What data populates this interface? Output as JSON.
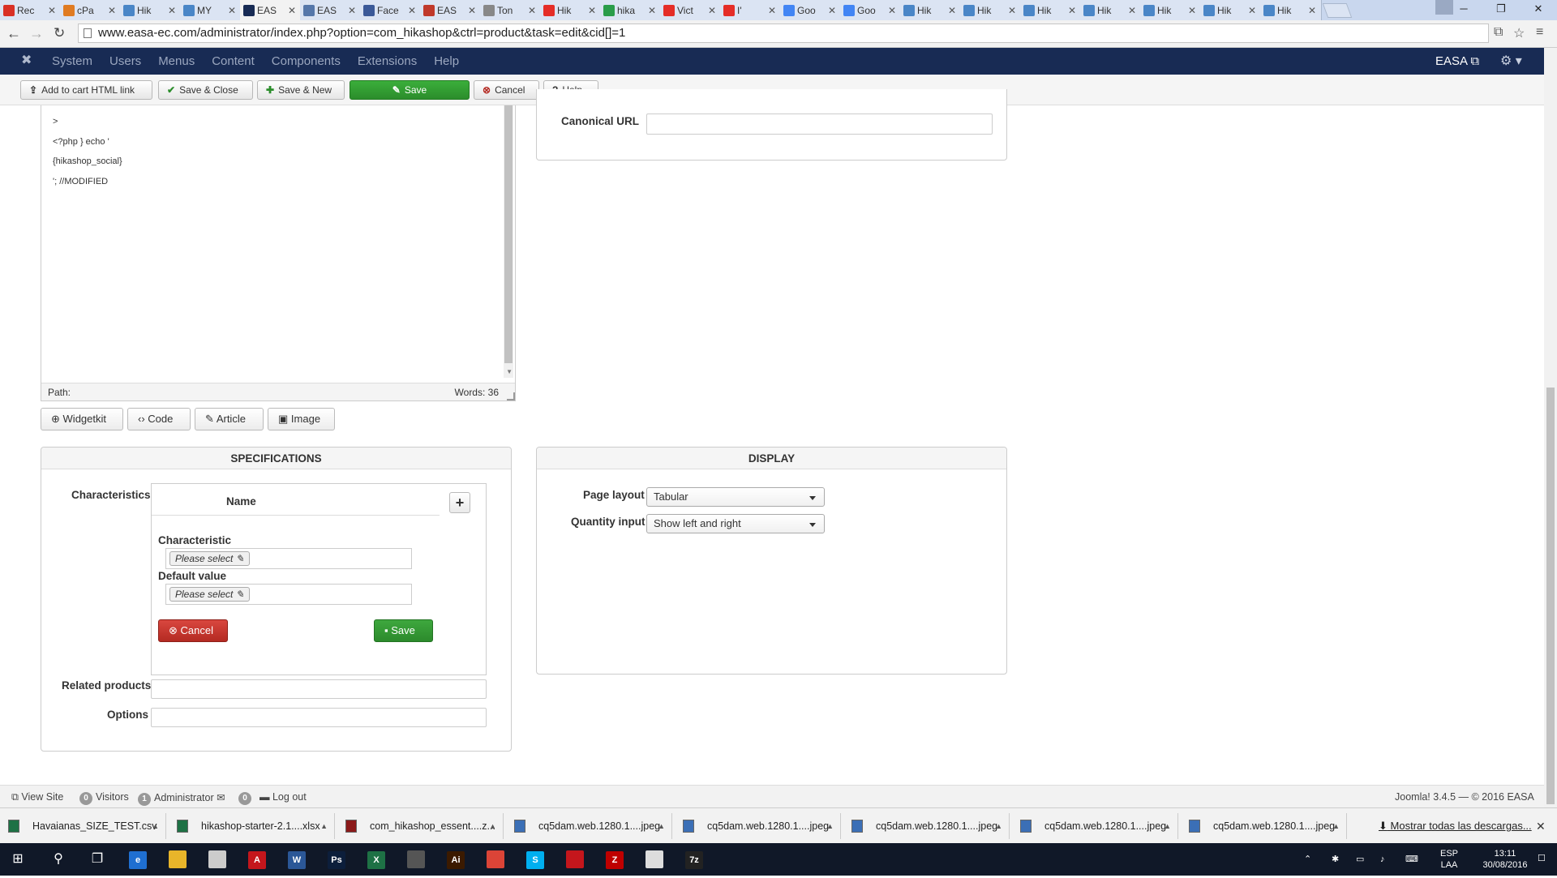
{
  "browser": {
    "tabs": [
      {
        "label": "Rec",
        "color": "#d93025",
        "active": false
      },
      {
        "label": "cPa",
        "color": "#e07b22",
        "active": false
      },
      {
        "label": "Hik",
        "color": "#4a86c7",
        "active": false
      },
      {
        "label": "MY",
        "color": "#4a86c7",
        "active": false
      },
      {
        "label": "EAS",
        "color": "#182b54",
        "active": true
      },
      {
        "label": "EAS",
        "color": "#5577aa",
        "active": false
      },
      {
        "label": "Face",
        "color": "#3b5998",
        "active": false
      },
      {
        "label": "EAS",
        "color": "#c0392b",
        "active": false
      },
      {
        "label": "Ton",
        "color": "#888888",
        "active": false
      },
      {
        "label": "Hik",
        "color": "#e52d27",
        "active": false
      },
      {
        "label": "hika",
        "color": "#2a9d4a",
        "active": false
      },
      {
        "label": "Vict",
        "color": "#e52d27",
        "active": false
      },
      {
        "label": "I'",
        "color": "#e52d27",
        "active": false
      },
      {
        "label": "Goo",
        "color": "#4285f4",
        "active": false
      },
      {
        "label": "Goo",
        "color": "#4285f4",
        "active": false
      },
      {
        "label": "Hik",
        "color": "#4a86c7",
        "active": false
      },
      {
        "label": "Hik",
        "color": "#4a86c7",
        "active": false
      },
      {
        "label": "Hik",
        "color": "#4a86c7",
        "active": false
      },
      {
        "label": "Hik",
        "color": "#4a86c7",
        "active": false
      },
      {
        "label": "Hik",
        "color": "#4a86c7",
        "active": false
      },
      {
        "label": "Hik",
        "color": "#4a86c7",
        "active": false
      },
      {
        "label": "Hik",
        "color": "#4a86c7",
        "active": false
      }
    ],
    "url": "www.easa-ec.com/administrator/index.php?option=com_hikashop&ctrl=product&task=edit&cid[]=1"
  },
  "joomla": {
    "menu": [
      "System",
      "Users",
      "Menus",
      "Content",
      "Components",
      "Extensions",
      "Help"
    ],
    "site": "EASA"
  },
  "toolbar": {
    "add_cart": "Add to cart HTML link",
    "save_close": "Save & Close",
    "save_new": "Save & New",
    "save": "Save",
    "cancel": "Cancel",
    "help": "Help"
  },
  "editor": {
    "lines": [
      ">",
      "<?php } echo '",
      "{hikashop_social}",
      "'; //MODIFIED"
    ],
    "path": "Path:",
    "words": "Words: 36",
    "buttons": {
      "widgetkit": "Widgetkit",
      "code": "Code",
      "article": "Article",
      "image": "Image"
    }
  },
  "seo": {
    "canonical_label": "Canonical URL",
    "canonical_value": ""
  },
  "specifications": {
    "title": "SPECIFICATIONS",
    "characteristics_label": "Characteristics",
    "name_header": "Name",
    "characteristic_label": "Characteristic",
    "characteristic_placeholder": "Please select",
    "default_label": "Default value",
    "default_placeholder": "Please select",
    "cancel": "Cancel",
    "save": "Save",
    "related_label": "Related products",
    "options_label": "Options"
  },
  "display": {
    "title": "DISPLAY",
    "layout_label": "Page layout",
    "layout_value": "Tabular",
    "quantity_label": "Quantity input",
    "quantity_value": "Show left and right"
  },
  "status": {
    "view_site": "View Site",
    "visitors_count": "0",
    "visitors": "Visitors",
    "admin_count": "1",
    "admin": "Administrator",
    "msg_count": "0",
    "logout": "Log out",
    "version": "Joomla! 3.4.5 — © 2016 EASA"
  },
  "downloads": {
    "items": [
      {
        "name": "Havaianas_SIZE_TEST.csv",
        "color": "#1e7145"
      },
      {
        "name": "hikashop-starter-2.1....xlsx",
        "color": "#1e7145"
      },
      {
        "name": "com_hikashop_essent....z...",
        "color": "#8b1a1a"
      },
      {
        "name": "cq5dam.web.1280.1....jpeg",
        "color": "#3b6fb6"
      },
      {
        "name": "cq5dam.web.1280.1....jpeg",
        "color": "#3b6fb6"
      },
      {
        "name": "cq5dam.web.1280.1....jpeg",
        "color": "#3b6fb6"
      },
      {
        "name": "cq5dam.web.1280.1....jpeg",
        "color": "#3b6fb6"
      },
      {
        "name": "cq5dam.web.1280.1....jpeg",
        "color": "#3b6fb6"
      }
    ],
    "show_all": "Mostrar todas las descargas..."
  },
  "taskbar": {
    "apps": [
      {
        "name": "start-icon",
        "glyph": "⊞",
        "color": ""
      },
      {
        "name": "search-icon",
        "glyph": "⚲",
        "color": ""
      },
      {
        "name": "task-view-icon",
        "glyph": "❐",
        "color": ""
      },
      {
        "name": "edge-icon",
        "glyph": "e",
        "color": "#1f6fd1"
      },
      {
        "name": "file-explorer-icon",
        "glyph": "",
        "color": "#e8b52a"
      },
      {
        "name": "store-icon",
        "glyph": "",
        "color": "#cccccc"
      },
      {
        "name": "acrobat-icon",
        "glyph": "A",
        "color": "#c4161c"
      },
      {
        "name": "word-icon",
        "glyph": "W",
        "color": "#2b5797"
      },
      {
        "name": "photoshop-icon",
        "glyph": "Ps",
        "color": "#0c1e3b"
      },
      {
        "name": "excel-icon",
        "glyph": "X",
        "color": "#1e7145"
      },
      {
        "name": "calculator-icon",
        "glyph": "",
        "color": "#555555"
      },
      {
        "name": "illustrator-icon",
        "glyph": "Ai",
        "color": "#3b1a00"
      },
      {
        "name": "chrome-icon",
        "glyph": "",
        "color": "#db4437"
      },
      {
        "name": "skype-icon",
        "glyph": "S",
        "color": "#00aff0"
      },
      {
        "name": "pdf-icon",
        "glyph": "",
        "color": "#c4161c"
      },
      {
        "name": "filezilla-icon",
        "glyph": "Z",
        "color": "#bf0000"
      },
      {
        "name": "photos-icon",
        "glyph": "",
        "color": "#dddddd"
      },
      {
        "name": "7zip-icon",
        "glyph": "7z",
        "color": "#222222"
      }
    ],
    "lang": "ESP",
    "layout": "LAA",
    "time": "13:11",
    "date": "30/08/2016"
  }
}
